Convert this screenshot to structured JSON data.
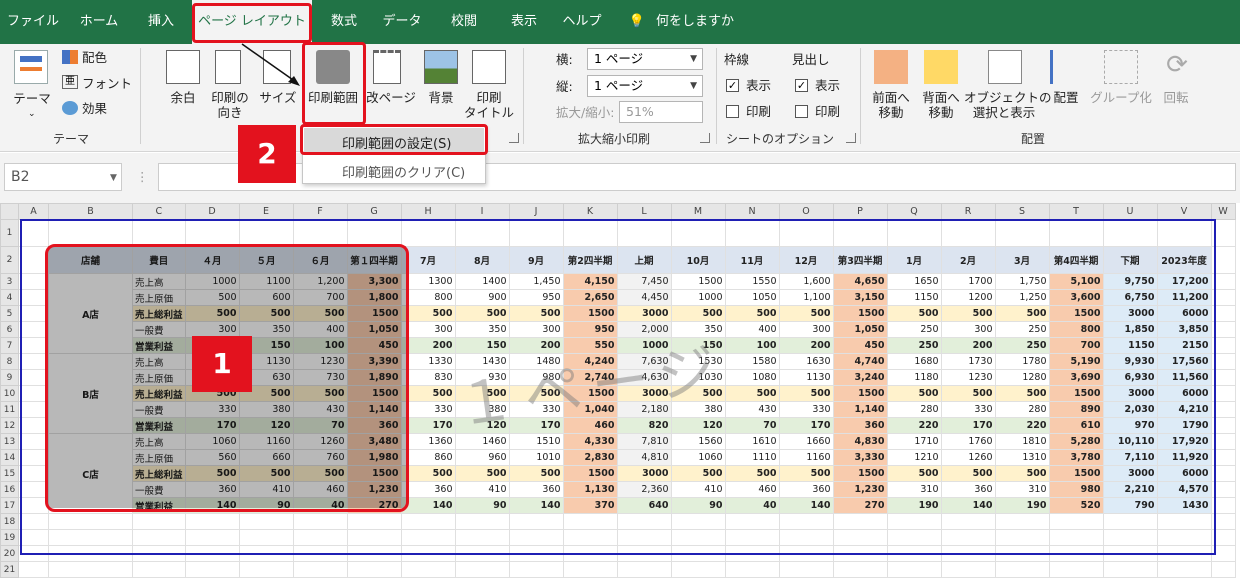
{
  "tabs": [
    "ファイル",
    "ホーム",
    "挿入",
    "ページ レイアウト",
    "数式",
    "データ",
    "校閲",
    "表示",
    "ヘルプ"
  ],
  "tell_me": "何をしますか",
  "ribbon": {
    "theme": {
      "themes": "テーマ",
      "colors": "配色",
      "fonts": "フォント",
      "effects": "効果",
      "group": "テーマ"
    },
    "margins": "余白",
    "orientation": "印刷の\n向き",
    "size": "サイズ",
    "print_area": "印刷範囲",
    "breaks": "改ページ",
    "background": "背景",
    "print_titles": "印刷\nタイトル",
    "scale": {
      "width_label": "横:",
      "width_value": "1 ページ",
      "height_label": "縦:",
      "height_value": "1 ページ",
      "scale_label": "拡大/縮小:",
      "scale_value": "51%",
      "group": "拡大縮小印刷"
    },
    "sheet_opts": {
      "gridlines": "枠線",
      "headings": "見出し",
      "view": "表示",
      "print": "印刷",
      "group": "シートのオプション"
    },
    "arrange": {
      "forward": "前面へ\n移動",
      "backward": "背面へ\n移動",
      "selection": "オブジェクトの\n選択と表示",
      "align": "配置",
      "group_btn": "グループ化",
      "rotate": "回転",
      "group": "配置"
    }
  },
  "menu": {
    "set": "印刷範囲の設定(S)",
    "clear": "印刷範囲のクリア(C)"
  },
  "name_box": "B2",
  "columns": [
    "A",
    "B",
    "C",
    "D",
    "E",
    "F",
    "G",
    "H",
    "I",
    "J",
    "K",
    "L",
    "M",
    "N",
    "O",
    "P",
    "Q",
    "R",
    "S",
    "T",
    "U",
    "V",
    "W"
  ],
  "header_row": [
    "店舗",
    "費目",
    "４月",
    "５月",
    "６月",
    "第１四半期",
    "7月",
    "8月",
    "9月",
    "第2四半期",
    "上期",
    "10月",
    "11月",
    "12月",
    "第3四半期",
    "1月",
    "2月",
    "3月",
    "第4四半期",
    "下期",
    "2023年度"
  ],
  "stores": [
    "A店",
    "B店",
    "C店"
  ],
  "rows": [
    [
      "売上高",
      "1000",
      "1100",
      "1,200",
      "3,300",
      "1300",
      "1400",
      "1,450",
      "4,150",
      "7,450",
      "1500",
      "1550",
      "1,600",
      "4,650",
      "1650",
      "1700",
      "1,750",
      "5,100",
      "9,750",
      "17,200"
    ],
    [
      "売上原価",
      "500",
      "600",
      "700",
      "1,800",
      "800",
      "900",
      "950",
      "2,650",
      "4,450",
      "1000",
      "1050",
      "1,100",
      "3,150",
      "1150",
      "1200",
      "1,250",
      "3,600",
      "6,750",
      "11,200"
    ],
    [
      "売上総利益",
      "500",
      "500",
      "500",
      "1500",
      "500",
      "500",
      "500",
      "1500",
      "3000",
      "500",
      "500",
      "500",
      "1500",
      "500",
      "500",
      "500",
      "1500",
      "3000",
      "6000"
    ],
    [
      "一般費",
      "300",
      "350",
      "400",
      "1,050",
      "300",
      "350",
      "300",
      "950",
      "2,000",
      "350",
      "400",
      "300",
      "1,050",
      "250",
      "300",
      "250",
      "800",
      "1,850",
      "3,850"
    ],
    [
      "営業利益",
      "200",
      "150",
      "100",
      "450",
      "200",
      "150",
      "200",
      "550",
      "1000",
      "150",
      "100",
      "200",
      "450",
      "250",
      "200",
      "250",
      "700",
      "1150",
      "2150"
    ],
    [
      "売上高",
      "1030",
      "1130",
      "1230",
      "3,390",
      "1330",
      "1430",
      "1480",
      "4,240",
      "7,630",
      "1530",
      "1580",
      "1630",
      "4,740",
      "1680",
      "1730",
      "1780",
      "5,190",
      "9,930",
      "17,560"
    ],
    [
      "売上原価",
      "530",
      "630",
      "730",
      "1,890",
      "830",
      "930",
      "980",
      "2,740",
      "4,630",
      "1030",
      "1080",
      "1130",
      "3,240",
      "1180",
      "1230",
      "1280",
      "3,690",
      "6,930",
      "11,560"
    ],
    [
      "売上総利益",
      "500",
      "500",
      "500",
      "1500",
      "500",
      "500",
      "500",
      "1500",
      "3000",
      "500",
      "500",
      "500",
      "1500",
      "500",
      "500",
      "500",
      "1500",
      "3000",
      "6000"
    ],
    [
      "一般費",
      "330",
      "380",
      "430",
      "1,140",
      "330",
      "380",
      "330",
      "1,040",
      "2,180",
      "380",
      "430",
      "330",
      "1,140",
      "280",
      "330",
      "280",
      "890",
      "2,030",
      "4,210"
    ],
    [
      "営業利益",
      "170",
      "120",
      "70",
      "360",
      "170",
      "120",
      "170",
      "460",
      "820",
      "120",
      "70",
      "170",
      "360",
      "220",
      "170",
      "220",
      "610",
      "970",
      "1790"
    ],
    [
      "売上高",
      "1060",
      "1160",
      "1260",
      "3,480",
      "1360",
      "1460",
      "1510",
      "4,330",
      "7,810",
      "1560",
      "1610",
      "1660",
      "4,830",
      "1710",
      "1760",
      "1810",
      "5,280",
      "10,110",
      "17,920"
    ],
    [
      "売上原価",
      "560",
      "660",
      "760",
      "1,980",
      "860",
      "960",
      "1010",
      "2,830",
      "4,810",
      "1060",
      "1110",
      "1160",
      "3,330",
      "1210",
      "1260",
      "1310",
      "3,780",
      "7,110",
      "11,920"
    ],
    [
      "売上総利益",
      "500",
      "500",
      "500",
      "1500",
      "500",
      "500",
      "500",
      "1500",
      "3000",
      "500",
      "500",
      "500",
      "1500",
      "500",
      "500",
      "500",
      "1500",
      "3000",
      "6000"
    ],
    [
      "一般費",
      "360",
      "410",
      "460",
      "1,230",
      "360",
      "410",
      "360",
      "1,130",
      "2,360",
      "410",
      "460",
      "360",
      "1,230",
      "310",
      "360",
      "310",
      "980",
      "2,210",
      "4,570"
    ],
    [
      "営業利益",
      "140",
      "90",
      "40",
      "270",
      "140",
      "90",
      "140",
      "370",
      "640",
      "90",
      "40",
      "140",
      "270",
      "190",
      "140",
      "190",
      "520",
      "790",
      "1430"
    ]
  ],
  "row_numbers": [
    "1",
    "2",
    "3",
    "4",
    "5",
    "6",
    "7",
    "8",
    "9",
    "10",
    "11",
    "12",
    "13",
    "14",
    "15",
    "16",
    "17",
    "18",
    "19",
    "20",
    "21"
  ],
  "page_watermark": "１ページ",
  "callouts": [
    "1",
    "2"
  ]
}
